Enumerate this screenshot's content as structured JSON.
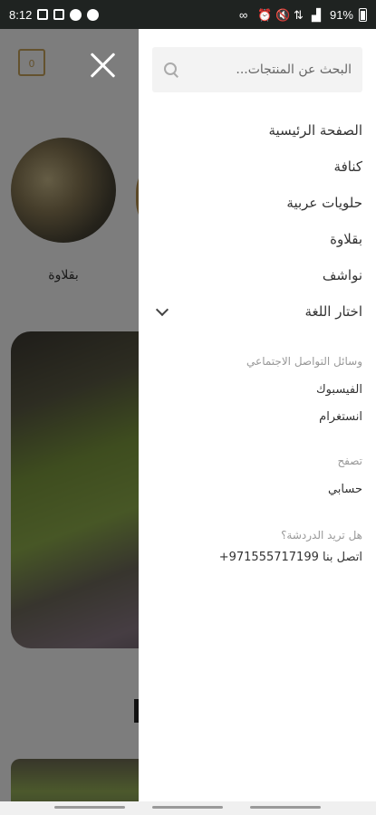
{
  "status_bar": {
    "time": "8:12",
    "battery": "91%",
    "left_icons": [
      "gallery-icon",
      "mail-icon",
      "messenger-icon",
      "whatsapp-icon"
    ],
    "right_icons": [
      "link-icon",
      "alarm-icon",
      "mute-icon",
      "data-icon",
      "signal-icon",
      "battery-icon"
    ]
  },
  "background": {
    "cart_count": "0",
    "category_label": "بقلاوة"
  },
  "drawer": {
    "search_placeholder": "البحث عن المنتجات...",
    "menu": {
      "home": "الصفحة الرئيسية",
      "kunafa": "كنافة",
      "arabic_sweets": "حلويات عربية",
      "baklava": "بقلاوة",
      "nawashef": "نواشف",
      "choose_language": "اختار اللغة"
    },
    "social": {
      "title": "وسائل التواصل الاجتماعي",
      "facebook": "الفيسبوك",
      "instagram": "انستغرام"
    },
    "browse": {
      "title": "تصفح",
      "account": "حسابي"
    },
    "chat": {
      "title": "هل تريد الدردشة؟",
      "contact_label": "اتصل بنا",
      "phone": "+971555717199"
    }
  },
  "colors": {
    "accent": "#c9a45c",
    "status_bar": "#1f2321",
    "overlay": "#000000"
  }
}
